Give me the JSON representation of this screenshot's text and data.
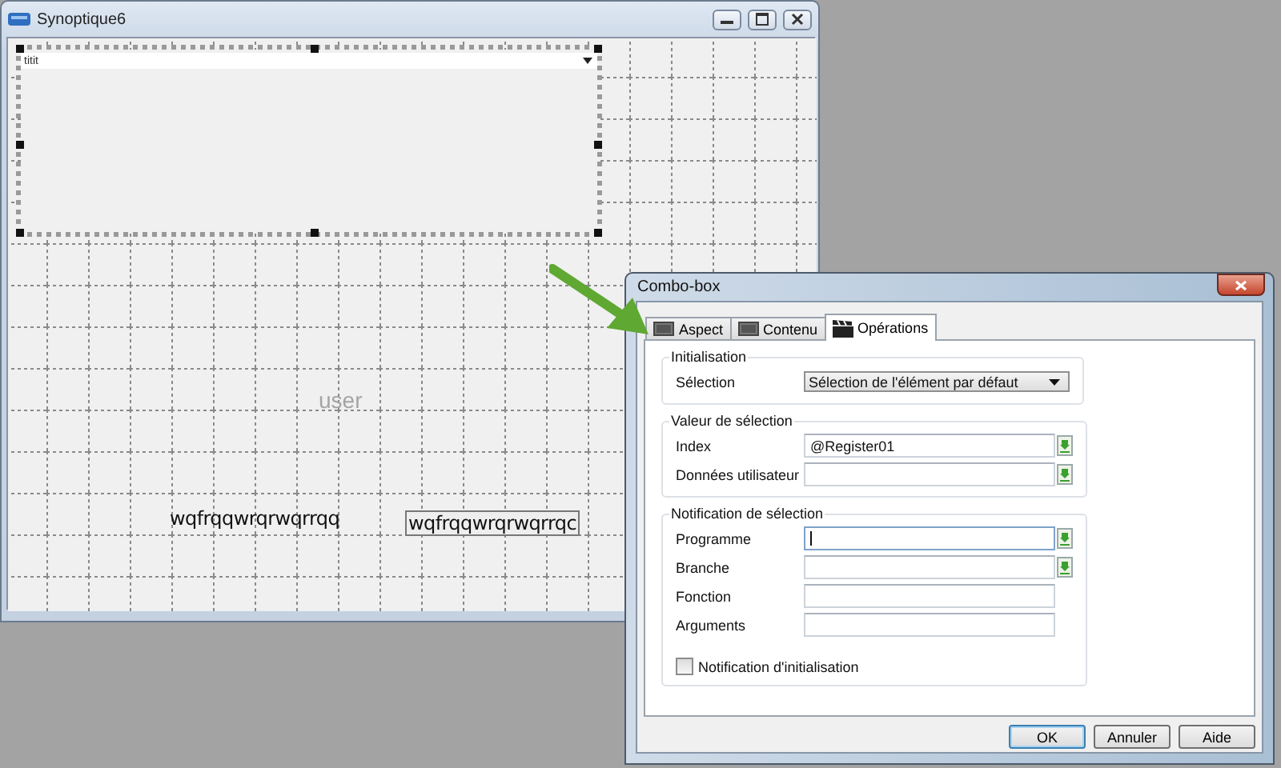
{
  "designer_window": {
    "title": "Synoptique6",
    "combo_value": "titit",
    "user_label": "user",
    "text_plain": "wqfrqqwrqrwqrrqq",
    "text_boxed": "wqfrqqwrqrwqrrqc"
  },
  "dialog": {
    "title": "Combo-box",
    "tabs": [
      {
        "label": "Aspect",
        "selected": false,
        "kind": "panel"
      },
      {
        "label": "Contenu",
        "selected": false,
        "kind": "panel"
      },
      {
        "label": "Opérations",
        "selected": true,
        "kind": "clapper"
      }
    ],
    "initialisation": {
      "title": "Initialisation",
      "label": "Sélection",
      "value": "Sélection de l'élément par défaut"
    },
    "selection_value": {
      "title": "Valeur de sélection",
      "fields": [
        {
          "label": "Index",
          "value": "@Register01",
          "picker": true,
          "focused": false
        },
        {
          "label": "Données utilisateur",
          "picker": true,
          "focused": false
        }
      ]
    },
    "notification": {
      "title": "Notification de sélection",
      "fields": [
        {
          "label": "Programme",
          "picker": true,
          "focused": true
        },
        {
          "label": "Branche",
          "picker": true,
          "focused": false
        },
        {
          "label": "Fonction",
          "picker": false,
          "focused": false
        },
        {
          "label": "Arguments",
          "picker": false,
          "focused": false
        }
      ],
      "checkbox": {
        "label": "Notification d'initialisation",
        "checked": false
      }
    },
    "buttons": [
      {
        "label": "OK",
        "default": true
      },
      {
        "label": "Annuler",
        "default": false
      },
      {
        "label": "Aide",
        "default": false
      }
    ]
  }
}
